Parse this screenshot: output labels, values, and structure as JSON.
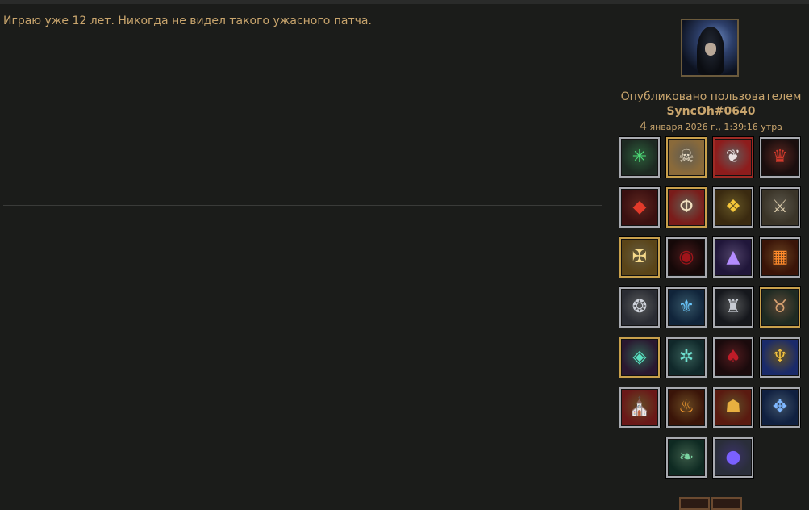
{
  "post": {
    "body": "Играю уже 12 лет. Никогда не видел такого ужасного патча."
  },
  "author": {
    "avatar_icon": "hooded-character-portrait",
    "posted_by_label": "Опубликовано пользователем",
    "battletag": "SyncOh#0640",
    "date_day": "4",
    "date_rest": " января 2026 г., 1:39:16 утра"
  },
  "badges": [
    {
      "icon": "green-star-burst-icon",
      "glyph": "✳",
      "color": "#4fe07a",
      "bg": "#1d2a22",
      "frame": "silver"
    },
    {
      "icon": "bird-skull-icon",
      "glyph": "☠",
      "color": "#e8dcc4",
      "bg": "#8a6a3a",
      "frame": "gold"
    },
    {
      "icon": "red-wings-icon",
      "glyph": "❦",
      "color": "#e8e0e0",
      "bg": "#8e1c1c",
      "frame": "red"
    },
    {
      "icon": "demon-helm-icon",
      "glyph": "♛",
      "color": "#d33a2c",
      "bg": "#1a0e0e",
      "frame": "silver"
    },
    {
      "icon": "red-gem-crest-icon",
      "glyph": "◆",
      "color": "#e23a2a",
      "bg": "#3a1010",
      "frame": "silver"
    },
    {
      "icon": "pillar-sigil-icon",
      "glyph": "Φ",
      "color": "#f0e0c0",
      "bg": "#7a1c1a",
      "frame": "gold"
    },
    {
      "icon": "golden-lattice-icon",
      "glyph": "❖",
      "color": "#f5c73a",
      "bg": "#3a2a10",
      "frame": "silver"
    },
    {
      "icon": "crossed-blades-icon",
      "glyph": "⚔",
      "color": "#d8c8a8",
      "bg": "#3a3428",
      "frame": "silver"
    },
    {
      "icon": "golden-angel-crest-icon",
      "glyph": "✠",
      "color": "#f5d98a",
      "bg": "#5a4418",
      "frame": "gold"
    },
    {
      "icon": "blood-moon-icon",
      "glyph": "◉",
      "color": "#a0141a",
      "bg": "#150808",
      "frame": "silver"
    },
    {
      "icon": "violet-spire-icon",
      "glyph": "▲",
      "color": "#b48cff",
      "bg": "#20163a",
      "frame": "silver"
    },
    {
      "icon": "fire-lantern-icon",
      "glyph": "▦",
      "color": "#ff8a2a",
      "bg": "#3a1408",
      "frame": "silver"
    },
    {
      "icon": "skull-knot-icon",
      "glyph": "❂",
      "color": "#d0d4dc",
      "bg": "#2a2c33",
      "frame": "silver"
    },
    {
      "icon": "blue-blade-icon",
      "glyph": "⚜",
      "color": "#6ac8ff",
      "bg": "#10243a",
      "frame": "silver"
    },
    {
      "icon": "dark-sentinel-icon",
      "glyph": "♜",
      "color": "#c8ccd4",
      "bg": "#15171c",
      "frame": "silver"
    },
    {
      "icon": "horned-beast-icon",
      "glyph": "♉",
      "color": "#d6a070",
      "bg": "#1e2a22",
      "frame": "gold"
    },
    {
      "icon": "rainbow-gem-icon",
      "glyph": "◈",
      "color": "#5ae0c0",
      "bg": "#2a1830",
      "frame": "gold"
    },
    {
      "icon": "teal-insect-icon",
      "glyph": "✲",
      "color": "#6ee0d0",
      "bg": "#10282a",
      "frame": "silver"
    },
    {
      "icon": "crimson-cloak-icon",
      "glyph": "♠",
      "color": "#c01c28",
      "bg": "#1a0a0c",
      "frame": "silver"
    },
    {
      "icon": "golden-wings-icon",
      "glyph": "♆",
      "color": "#f0c040",
      "bg": "#1a2a6a",
      "frame": "silver"
    },
    {
      "icon": "cathedral-window-icon",
      "glyph": "⛪",
      "color": "#f0b040",
      "bg": "#6a1818",
      "frame": "silver"
    },
    {
      "icon": "flame-guardian-icon",
      "glyph": "♨",
      "color": "#ffa030",
      "bg": "#3a1408",
      "frame": "silver"
    },
    {
      "icon": "golden-demon-face-icon",
      "glyph": "☗",
      "color": "#e8b040",
      "bg": "#5a1a10",
      "frame": "silver"
    },
    {
      "icon": "blue-axe-crest-icon",
      "glyph": "✥",
      "color": "#80b8ff",
      "bg": "#102040",
      "frame": "silver"
    },
    {
      "icon": "green-tree-icon",
      "glyph": "❧",
      "color": "#7ad4a0",
      "bg": "#0e2a22",
      "frame": "silver"
    },
    {
      "icon": "arcane-orb-icon",
      "glyph": "●",
      "color": "#7a60ff",
      "bg": "#2a2e3a",
      "frame": "silver"
    }
  ]
}
